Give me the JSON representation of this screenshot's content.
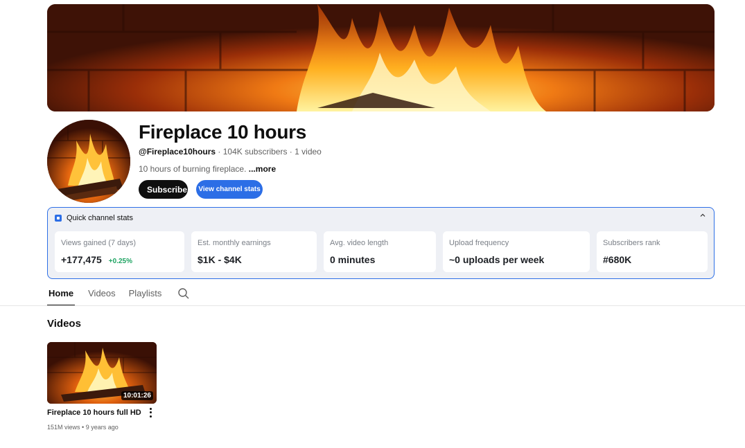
{
  "channel": {
    "name": "Fireplace 10 hours",
    "handle": "@Fireplace10hours",
    "subscribers": "104K subscribers",
    "video_count": "1 video",
    "separator": " · ",
    "description": "10 hours of burning fireplace. ",
    "more_label": "...more"
  },
  "actions": {
    "subscribe_label": "Subscribe",
    "view_stats_label": "View channel stats"
  },
  "stats_panel": {
    "title": "Quick channel stats",
    "cards": [
      {
        "label": "Views gained (7 days)",
        "value": "+177,475",
        "delta": "+0.25%"
      },
      {
        "label": "Est. monthly earnings",
        "value": "$1K - $4K"
      },
      {
        "label": "Avg. video length",
        "value": "0 minutes"
      },
      {
        "label": "Upload frequency",
        "value": "~0 uploads per week"
      },
      {
        "label": "Subscribers rank",
        "value": "#680K"
      }
    ]
  },
  "tabs": [
    {
      "label": "Home",
      "active": true
    },
    {
      "label": "Videos",
      "active": false
    },
    {
      "label": "Playlists",
      "active": false
    }
  ],
  "videos_section": {
    "title": "Videos",
    "items": [
      {
        "title": "Fireplace 10 hours full HD",
        "duration": "10:01:26",
        "views": "151M views",
        "age": "9 years ago",
        "separator": " • "
      }
    ]
  },
  "colors": {
    "accent": "#2c6ee6",
    "delta_positive": "#1ea362",
    "subscribe_bg": "#0f0f0f"
  },
  "icons": {
    "stats_logo": "stats-logo-icon",
    "collapse": "chevron-up-icon",
    "search": "search-icon",
    "menu": "more-vert-icon"
  }
}
